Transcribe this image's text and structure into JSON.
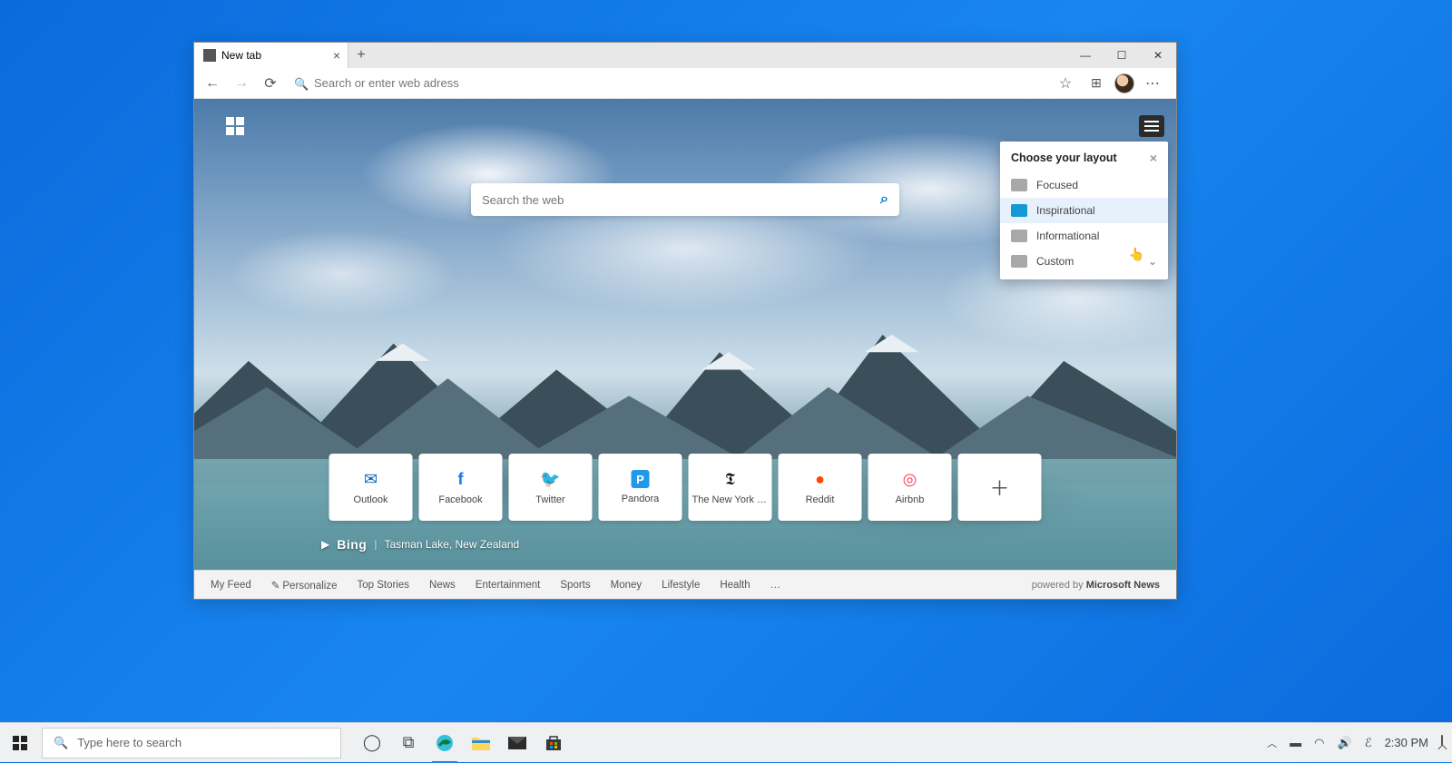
{
  "browser": {
    "tab": {
      "title": "New tab"
    },
    "omnibox_placeholder": "Search or enter web adress",
    "win_controls": {
      "min": "—",
      "max": "☐",
      "close": "✕"
    }
  },
  "newtab": {
    "web_search_placeholder": "Search the web",
    "bing_label": "Bing",
    "bing_location": "Tasman Lake, New Zealand",
    "tiles": [
      {
        "label": "Outlook",
        "color": "#0364b8",
        "glyph": "✉"
      },
      {
        "label": "Facebook",
        "color": "#1877f2",
        "glyph": "f"
      },
      {
        "label": "Twitter",
        "color": "#1da1f2",
        "glyph": "🐦"
      },
      {
        "label": "Pandora",
        "color": "#2299e8",
        "glyph": "P"
      },
      {
        "label": "The New York Ti...",
        "color": "#111",
        "glyph": "𝕿"
      },
      {
        "label": "Reddit",
        "color": "#ff4500",
        "glyph": "●"
      },
      {
        "label": "Airbnb",
        "color": "#ff385c",
        "glyph": "◎"
      }
    ],
    "add_tile_glyph": "＋"
  },
  "layout_flyout": {
    "title": "Choose your layout",
    "options": [
      {
        "label": "Focused",
        "selected": false
      },
      {
        "label": "Inspirational",
        "selected": true
      },
      {
        "label": "Informational",
        "selected": false
      },
      {
        "label": "Custom",
        "selected": false,
        "expandable": true
      }
    ]
  },
  "feedbar": {
    "items": [
      "My Feed",
      "Personalize",
      "Top Stories",
      "News",
      "Entertainment",
      "Sports",
      "Money",
      "Lifestyle",
      "Health",
      "…"
    ],
    "powered_prefix": "powered by ",
    "powered_name": "Microsoft News"
  },
  "taskbar": {
    "search_placeholder": "Type here to search",
    "clock": "2:30 PM"
  }
}
